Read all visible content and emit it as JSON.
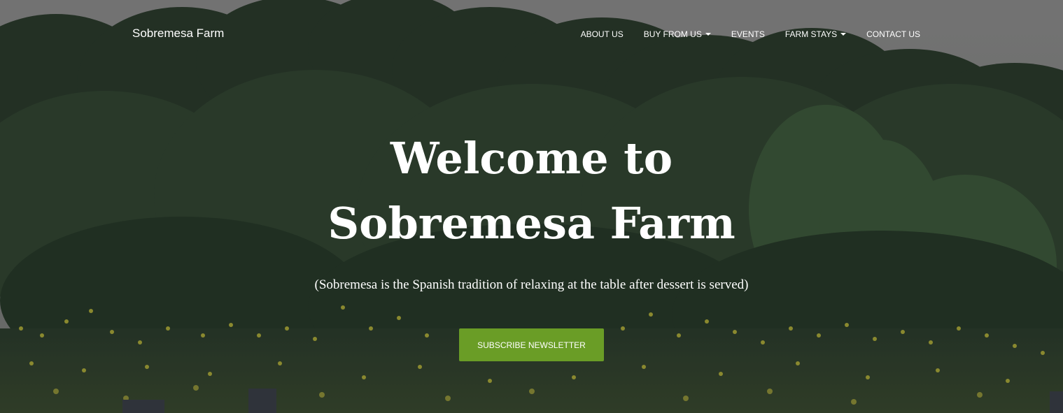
{
  "nav": {
    "brand": "Sobremesa Farm",
    "items": [
      {
        "label": "ABOUT US",
        "dropdown": false
      },
      {
        "label": "BUY FROM US",
        "dropdown": true
      },
      {
        "label": "EVENTS",
        "dropdown": false
      },
      {
        "label": "FARM STAYS",
        "dropdown": true
      },
      {
        "label": "CONTACT US",
        "dropdown": false
      }
    ]
  },
  "hero": {
    "title_line1": "Welcome to",
    "title_line2": "Sobremesa Farm",
    "subtitle": "(Sobremesa is the Spanish tradition of relaxing at the table after dessert is served)",
    "button_label": "SUBSCRIBE NEWSLETTER"
  },
  "colors": {
    "button": "#6a9d26",
    "sky": "#8a8a8a",
    "foliage": "#2a3a2c",
    "flowers": "#b5b23a"
  },
  "icons": {
    "dropdown": "caret-down-icon"
  }
}
